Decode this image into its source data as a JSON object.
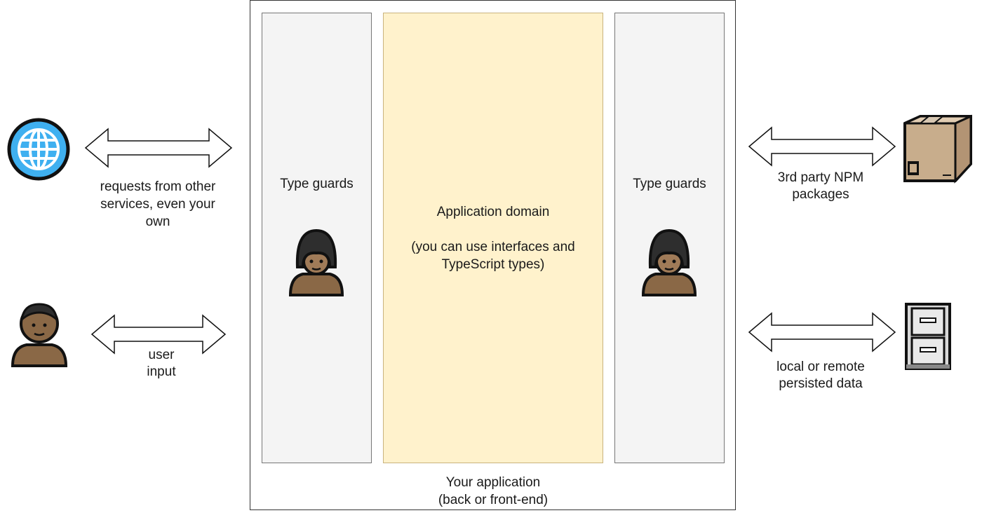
{
  "external_left": {
    "web_requests_label": [
      "requests from other",
      "services, even your",
      "own"
    ],
    "user_input_label": [
      "user",
      "input"
    ]
  },
  "application": {
    "left_guard_label": "Type guards",
    "right_guard_label": "Type guards",
    "domain_title": "Application domain",
    "domain_note": [
      "(you can use interfaces and",
      "TypeScript types)"
    ],
    "footer_label": [
      "Your application",
      "(back or front-end)"
    ]
  },
  "external_right": {
    "npm_label": [
      "3rd party NPM",
      "packages"
    ],
    "persisted_label": [
      "local or remote",
      "persisted data"
    ]
  },
  "colors": {
    "domain_fill": "#fff2cc",
    "guard_fill": "#f4f4f4",
    "globe_blue": "#3fb0f0",
    "skin": "#8a6846",
    "hat": "#2e2e2e"
  },
  "icons": [
    "globe-icon",
    "user-icon",
    "guard-icon",
    "guard-icon",
    "package-box-icon",
    "file-cabinet-icon"
  ]
}
